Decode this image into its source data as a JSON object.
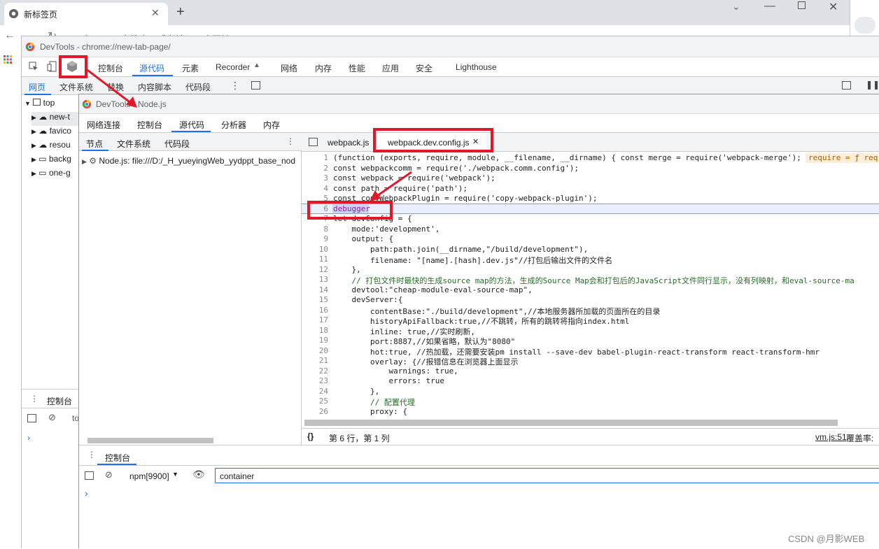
{
  "browser": {
    "tab_title": "新标签页",
    "new_tab_symbol": "+",
    "address_text": "在Google中搜索，或者输入一个网址"
  },
  "devtools_outer": {
    "title": "DevTools - chrome://new-tab-page/",
    "tabs": [
      "控制台",
      "源代码",
      "元素",
      "Recorder",
      "网络",
      "内存",
      "性能",
      "应用",
      "安全",
      "Lighthouse"
    ],
    "active_tab": "源代码",
    "subtabs": [
      "网页",
      "文件系统",
      "替换",
      "内容脚本",
      "代码段"
    ],
    "tree": [
      "top",
      "new-t",
      "favico",
      "resou",
      "backg",
      "one-g"
    ],
    "drawer_tab": "控制台",
    "drawer_filter": "to"
  },
  "devtools_inner": {
    "title": "DevTools - Node.js",
    "tabs": [
      "网络连接",
      "控制台",
      "源代码",
      "分析器",
      "内存"
    ],
    "active_tab": "源代码",
    "nav_tabs": [
      "节点",
      "文件系统",
      "代码段"
    ],
    "nav_item": "Node.js:  file:///D:/_H_yueyingWeb_yydppt_base_nod",
    "editor_tabs": [
      "webpack.js",
      "webpack.dev.config.js"
    ],
    "active_editor_tab": "webpack.dev.config.js",
    "inline_hint": "require = ƒ req",
    "status": "第 6 行，第 1 列",
    "status_right_link": "vm.js:51",
    "status_right_text": "覆盖率:",
    "drawer_tab": "控制台",
    "context": "npm[9900]",
    "filter_value": "container"
  },
  "code_lines": [
    {
      "n": "1",
      "t": "(function (exports, require, module, __filename, __dirname) { const merge = require('webpack-merge');"
    },
    {
      "n": "2",
      "t": "const webpackcomm = require('./webpack.comm.config');"
    },
    {
      "n": "3",
      "t": "const webpack = require('webpack');"
    },
    {
      "n": "4",
      "t": "const path = require('path');"
    },
    {
      "n": "5",
      "t": "const copyWebpackPlugin = require('copy-webpack-plugin');"
    },
    {
      "n": "6",
      "t": "debugger"
    },
    {
      "n": "7",
      "t": "let devConfig = {"
    },
    {
      "n": "8",
      "t": "    mode:'development',"
    },
    {
      "n": "9",
      "t": "    output: {"
    },
    {
      "n": "10",
      "t": "        path:path.join(__dirname,\"/build/development\"),"
    },
    {
      "n": "11",
      "t": "        filename: \"[name].[hash].dev.js\"//打包后输出文件的文件名"
    },
    {
      "n": "12",
      "t": "    },"
    },
    {
      "n": "13",
      "t": "    // 打包文件时最快的生成source map的方法，生成的Source Map会和打包后的JavaScript文件同行显示，没有列映射，和eval-source-ma"
    },
    {
      "n": "14",
      "t": "    devtool:\"cheap-module-eval-source-map\","
    },
    {
      "n": "15",
      "t": "    devServer:{"
    },
    {
      "n": "16",
      "t": "        contentBase:\"./build/development\",//本地服务器所加载的页面所在的目录"
    },
    {
      "n": "17",
      "t": "        historyApiFallback:true,//不跳转，所有的跳转将指向index.html"
    },
    {
      "n": "18",
      "t": "        inline: true,//实时刷新,"
    },
    {
      "n": "19",
      "t": "        port:8887,//如果省略，默认为\"8080\""
    },
    {
      "n": "20",
      "t": "        hot:true, //热加载，还需要安装pm install --save-dev babel-plugin-react-transform react-transform-hmr"
    },
    {
      "n": "21",
      "t": "        overlay: {//报错信息在浏览器上面显示"
    },
    {
      "n": "22",
      "t": "            warnings: true,"
    },
    {
      "n": "23",
      "t": "            errors: true"
    },
    {
      "n": "24",
      "t": "        },"
    },
    {
      "n": "25",
      "t": "        // 配置代理"
    },
    {
      "n": "26",
      "t": "        proxy: {"
    }
  ],
  "watermark": "CSDN @月影WEB",
  "colors": {
    "highlight_box": "#e0192a",
    "active_tab_underline": "#1a73e8",
    "selection": "#c8d6fa"
  }
}
